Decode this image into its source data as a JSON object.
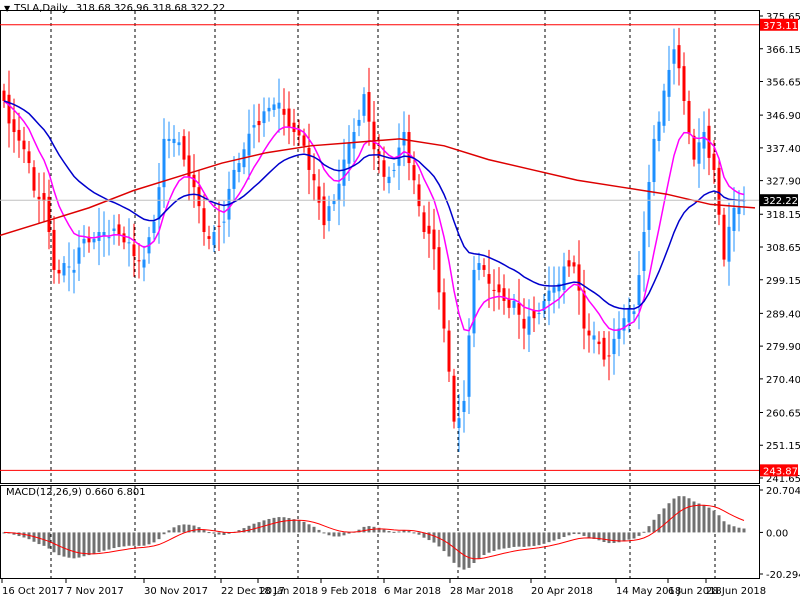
{
  "header": {
    "symbol": "TSLA,Daily",
    "ohlc": "318.68 326.96 318.68 322.22",
    "menu_icon": "triangle-down-icon"
  },
  "macd": {
    "label": "MACD(12,26,9) 0.660 6.801",
    "axis": [
      "20.704",
      "0.00",
      "-20.294"
    ],
    "range": [
      -20.294,
      20.704
    ]
  },
  "colors": {
    "bull": "#1e90ff",
    "bear": "#ff0000",
    "fast_ma": "#ff00ff",
    "mid_ma": "#0000cc",
    "slow_ma": "#dd0000",
    "hist": "#707070",
    "signal": "#ff0000"
  },
  "chart_data": {
    "type": "candlestick",
    "title": "TSLA,Daily",
    "ylim": [
      241.65,
      375.65
    ],
    "y_ticks": [
      "375.65",
      "366.15",
      "356.65",
      "346.90",
      "337.40",
      "327.90",
      "318.15",
      "308.65",
      "299.15",
      "289.40",
      "279.90",
      "270.40",
      "260.65",
      "251.15",
      "241.65"
    ],
    "x_labels": [
      "16 Oct 2017",
      "7 Nov 2017",
      "30 Nov 2017",
      "22 Dec 2017",
      "18 Jan 2018",
      "9 Feb 2018",
      "6 Mar 2018",
      "28 Mar 2018",
      "20 Apr 2018",
      "14 May 2018",
      "6 Jun 2018",
      "28 Jun 2018"
    ],
    "closes": [
      351,
      342,
      337,
      325,
      322,
      302,
      304,
      302,
      311,
      311,
      313,
      314,
      310,
      306,
      305,
      316,
      340,
      340,
      334,
      326,
      313,
      313,
      316,
      331,
      337,
      344,
      348,
      350,
      347,
      342,
      338,
      328,
      315,
      322,
      334,
      342,
      353,
      337,
      329,
      331,
      342,
      328,
      313,
      308,
      285,
      258,
      264,
      302,
      302,
      296,
      293,
      293,
      285,
      288,
      293,
      297,
      303,
      303,
      285,
      283,
      276,
      282,
      288,
      290,
      313,
      340,
      354,
      366,
      351,
      334,
      342,
      331,
      305,
      320,
      322.22
    ],
    "slow_ma": [
      312,
      316,
      320,
      325,
      329,
      333,
      336,
      338,
      339,
      340,
      338,
      334,
      331,
      328,
      326,
      324,
      321,
      320
    ],
    "price_lines": {
      "high": "373.11",
      "low": "243.87",
      "current": "322.22"
    }
  }
}
